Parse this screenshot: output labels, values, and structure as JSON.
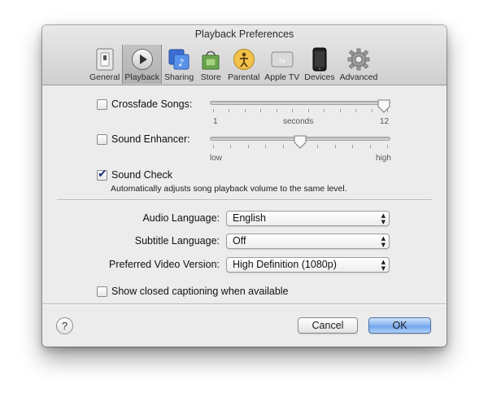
{
  "window": {
    "title": "Playback Preferences"
  },
  "toolbar": {
    "selected": "Playback",
    "items": [
      {
        "label": "General",
        "icon": "general-icon"
      },
      {
        "label": "Playback",
        "icon": "play-icon"
      },
      {
        "label": "Sharing",
        "icon": "sharing-icon"
      },
      {
        "label": "Store",
        "icon": "store-bag-icon"
      },
      {
        "label": "Parental",
        "icon": "parental-icon"
      },
      {
        "label": "Apple TV",
        "icon": "apple-tv-icon"
      },
      {
        "label": "Devices",
        "icon": "iphone-icon"
      },
      {
        "label": "Advanced",
        "icon": "gear-icon"
      }
    ]
  },
  "crossfade": {
    "label": "Crossfade Songs:",
    "checked": false,
    "min_label": "1",
    "mid_label": "seconds",
    "max_label": "12",
    "value": 12
  },
  "enhancer": {
    "label": "Sound Enhancer:",
    "checked": false,
    "min_label": "low",
    "max_label": "high",
    "level": 0.5
  },
  "sound_check": {
    "label": "Sound Check",
    "checked": true,
    "description": "Automatically adjusts song playback volume to the same level."
  },
  "audio_language": {
    "label": "Audio Language:",
    "value": "English"
  },
  "subtitle_language": {
    "label": "Subtitle Language:",
    "value": "Off"
  },
  "video_version": {
    "label": "Preferred Video Version:",
    "value": "High Definition (1080p)"
  },
  "captions": {
    "label": "Show closed captioning when available",
    "checked": false
  },
  "buttons": {
    "help": "?",
    "cancel": "Cancel",
    "ok": "OK"
  },
  "colors": {
    "ok_button": "#7aaaf0",
    "window_bg": "#ececec",
    "checkmark": "#1f3a7a"
  }
}
